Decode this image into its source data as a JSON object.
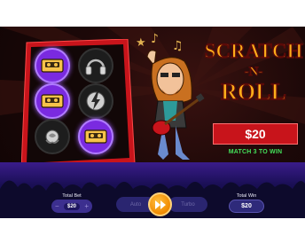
{
  "game": {
    "logo_line1": "SCRATCH",
    "logo_line2": "-N-",
    "logo_line3": "ROLL",
    "prize": "$20",
    "tagline": "MATCH 3 TO WIN"
  },
  "grid": {
    "symbols": [
      "cassette-icon",
      "headphones-icon",
      "cassette-icon",
      "lightning-guitar-icon",
      "rose-icon",
      "cassette-icon"
    ],
    "winning": [
      true,
      false,
      true,
      false,
      false,
      true
    ]
  },
  "controls": {
    "total_bet_label": "Total Bet",
    "total_bet_value": "$20",
    "minus": "−",
    "plus": "+",
    "auto_label": "Auto",
    "turbo_label": "Turbo",
    "total_win_label": "Total Win",
    "total_win_value": "$20"
  },
  "colors": {
    "win_highlight": "#7a2ae0",
    "prize_red": "#c8141b",
    "tagline_green": "#43e05a",
    "play_orange": "#f08a00"
  }
}
